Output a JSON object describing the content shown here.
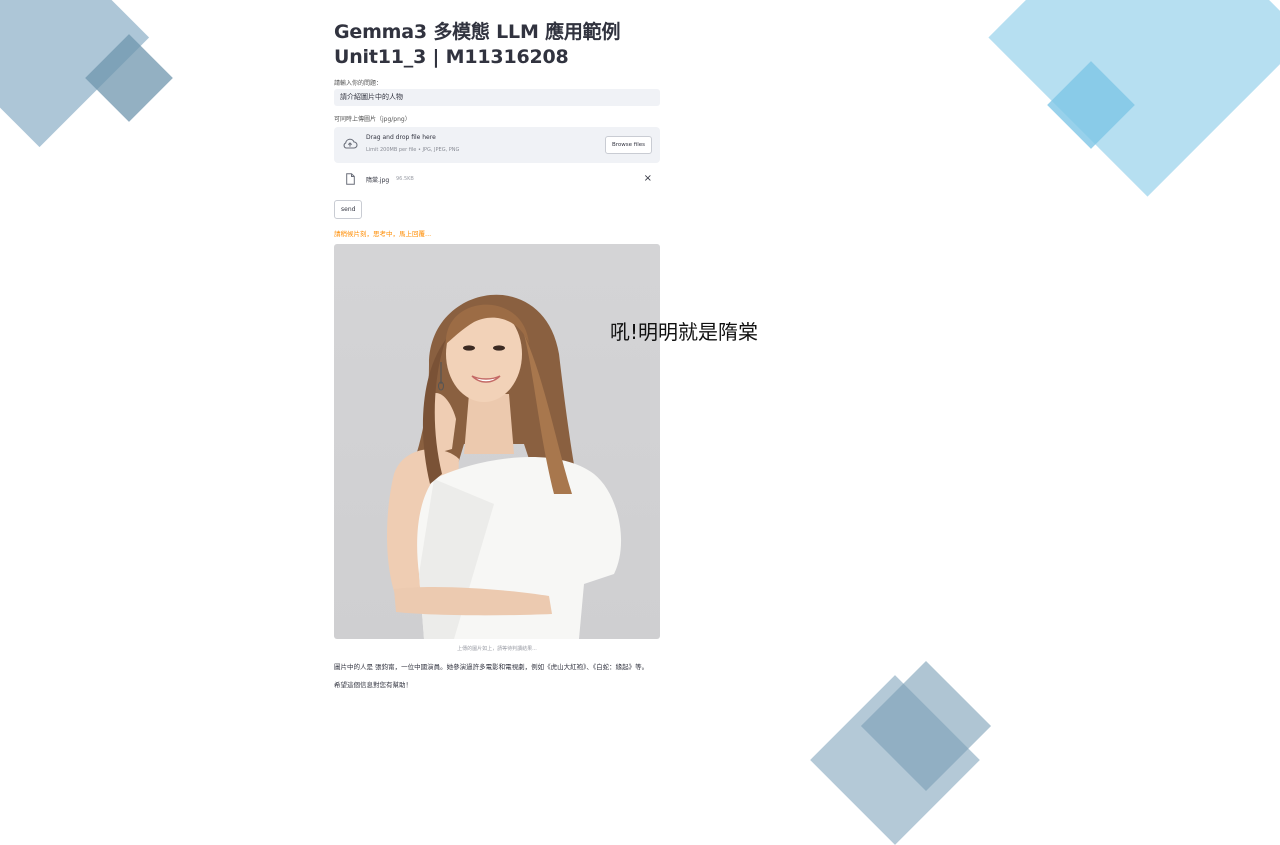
{
  "app": {
    "title_line1": "Gemma3 多模態 LLM 應用範例",
    "title_line2": "Unit11_3 | M11316208",
    "question_label": "請輸入你的問題：",
    "question_value": "請介紹圖片中的人物",
    "upload_label": "可同時上傳圖片（jpg/png）",
    "dropzone_title": "Drag and drop file here",
    "dropzone_limit": "Limit 200MB per file • JPG, JPEG, PNG",
    "browse_label": "Browse files",
    "file_name": "隋棠.jpg",
    "file_size": "96.5KB",
    "close_glyph": "×",
    "send_label": "send",
    "status_text": "請稍候片刻，思考中，馬上回覆...",
    "image_caption": "上傳的圖片如上，請等待判讀結果...",
    "answer_text": "圖片中的人是 張鈞甯，一位中國演員。她參演過許多電影和電視劇，例如《虎山大紅袍》、《白蛇：緣起》等。",
    "answer_followup": "希望這個信息對您有幫助！"
  },
  "overlay_text": "吼!明明就是隋棠",
  "colors": {
    "status": "#ff8c00",
    "input_bg": "#f0f2f6",
    "deco_blue": "#aedcf0",
    "deco_slate": "#9fbcd0"
  },
  "icons": [
    "cloud-upload-icon",
    "file-icon",
    "close-icon"
  ]
}
